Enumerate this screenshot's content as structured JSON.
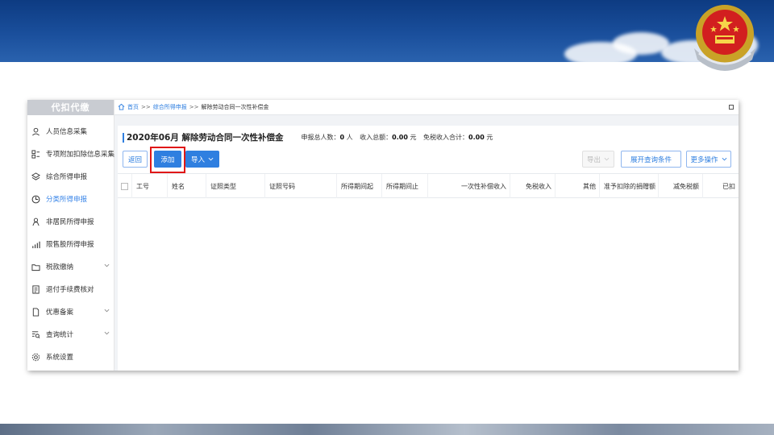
{
  "sidebar": {
    "title": "代扣代缴",
    "items": [
      {
        "label": "人员信息采集",
        "icon": "user-icon",
        "has_submenu": false
      },
      {
        "label": "专项附加扣除信息采集",
        "icon": "grid-list-icon",
        "has_submenu": false
      },
      {
        "label": "综合所得申报",
        "icon": "layers-icon",
        "has_submenu": false
      },
      {
        "label": "分类所得申报",
        "icon": "pie-clock-icon",
        "has_submenu": false,
        "active": true
      },
      {
        "label": "非居民所得申报",
        "icon": "person-icon",
        "has_submenu": false
      },
      {
        "label": "限售股所得申报",
        "icon": "bar-chart-icon",
        "has_submenu": false
      },
      {
        "label": "税款缴纳",
        "icon": "folder-icon",
        "has_submenu": true
      },
      {
        "label": "退付手续费核对",
        "icon": "document-icon",
        "has_submenu": false
      },
      {
        "label": "优惠备案",
        "icon": "file-icon",
        "has_submenu": true
      },
      {
        "label": "查询统计",
        "icon": "search-list-icon",
        "has_submenu": true
      },
      {
        "label": "系统设置",
        "icon": "gear-icon",
        "has_submenu": false
      }
    ]
  },
  "breadcrumb": {
    "home": "首页",
    "sep": ">>",
    "level1": "综合所得申报",
    "current": "解除劳动合同一次性补偿金"
  },
  "page": {
    "title": "2020年06月 解除劳动合同一次性补偿金",
    "stats": {
      "people_label": "申报总人数：",
      "people_value": "0",
      "people_unit": "人",
      "income_label": "收入总额：",
      "income_value": "0.00",
      "income_unit": "元",
      "taxfree_label": "免税收入合计：",
      "taxfree_value": "0.00",
      "taxfree_unit": "元"
    }
  },
  "toolbar": {
    "back": "返回",
    "add": "添加",
    "import": "导入",
    "export": "导出",
    "expand_query": "展开查询条件",
    "more_ops": "更多操作"
  },
  "table": {
    "columns": [
      "工号",
      "姓名",
      "证照类型",
      "证照号码",
      "所得期间起",
      "所得期间止",
      "一次性补偿收入",
      "免税收入",
      "其他",
      "准予扣除的捐赠额",
      "减免税额",
      "已扣"
    ],
    "rows": []
  },
  "colors": {
    "primary": "#2f7fe0",
    "highlight": "#e01717",
    "banner": "#1a4f9c"
  }
}
